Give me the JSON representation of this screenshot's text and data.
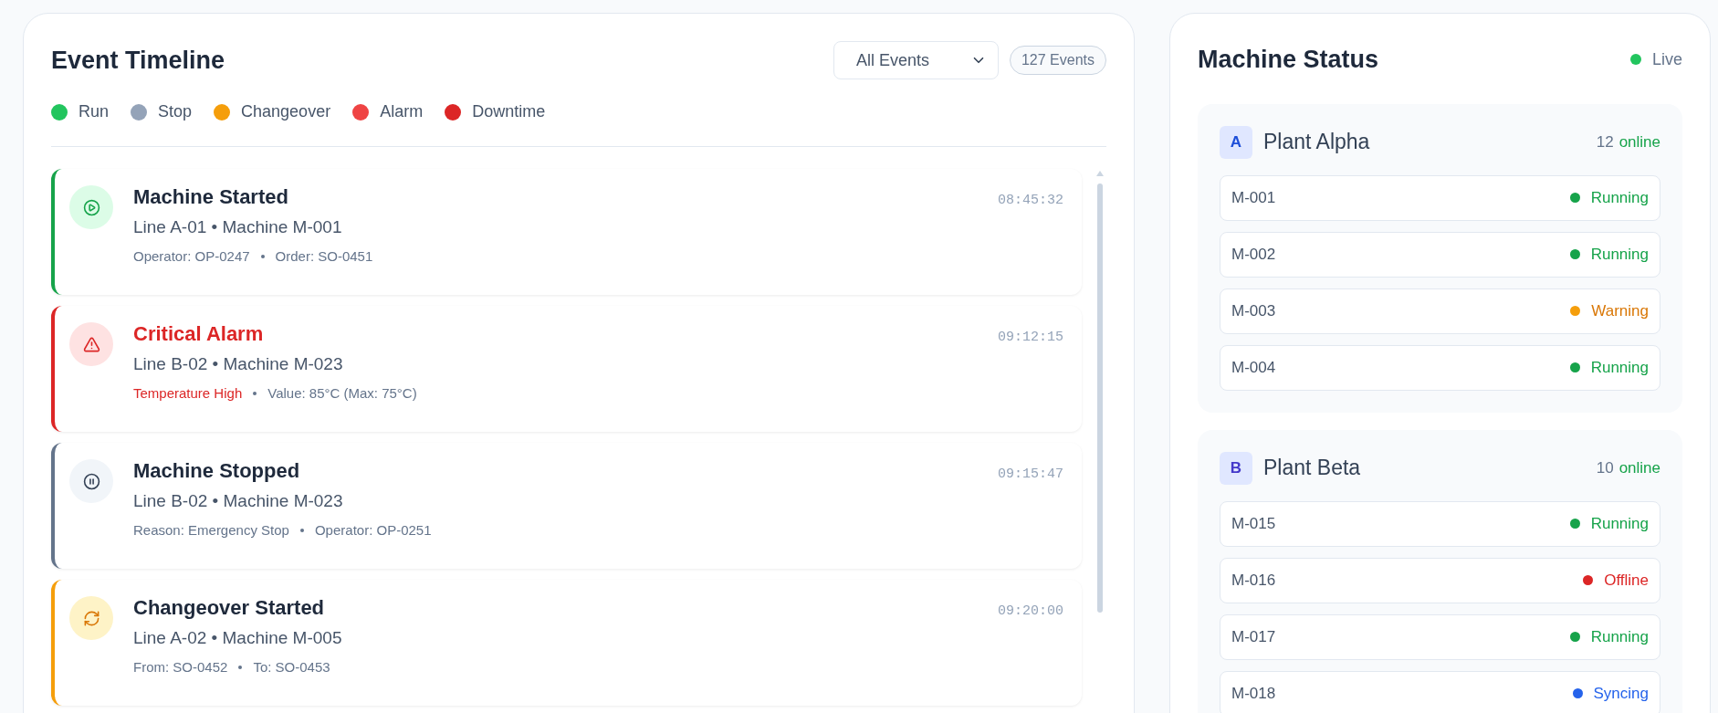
{
  "timeline": {
    "title": "Event Timeline",
    "filter": {
      "value": "All Events"
    },
    "count": "127 Events",
    "legend": [
      {
        "label": "Run",
        "color": "#22c55e"
      },
      {
        "label": "Stop",
        "color": "#94a3b8"
      },
      {
        "label": "Changeover",
        "color": "#f59e0b"
      },
      {
        "label": "Alarm",
        "color": "#ef4444"
      },
      {
        "label": "Downtime",
        "color": "#dc2626"
      }
    ],
    "events": [
      {
        "kind": "run",
        "title": "Machine Started",
        "location": "Line A-01 • Machine M-001",
        "time": "08:45:32",
        "details": [
          {
            "text": "Operator: OP-0247",
            "alert": false
          },
          {
            "text": "Order: SO-0451",
            "alert": false
          }
        ]
      },
      {
        "kind": "alarm",
        "title": "Critical Alarm",
        "location": "Line B-02 • Machine M-023",
        "time": "09:12:15",
        "details": [
          {
            "text": "Temperature High",
            "alert": true
          },
          {
            "text": "Value: 85°C (Max: 75°C)",
            "alert": false
          }
        ]
      },
      {
        "kind": "stop",
        "title": "Machine Stopped",
        "location": "Line B-02 • Machine M-023",
        "time": "09:15:47",
        "details": [
          {
            "text": "Reason: Emergency Stop",
            "alert": false
          },
          {
            "text": "Operator: OP-0251",
            "alert": false
          }
        ]
      },
      {
        "kind": "changeover",
        "title": "Changeover Started",
        "location": "Line A-02 • Machine M-005",
        "time": "09:20:00",
        "details": [
          {
            "text": "From: SO-0452",
            "alert": false
          },
          {
            "text": "To: SO-0453",
            "alert": false
          }
        ]
      }
    ]
  },
  "machine_status": {
    "title": "Machine Status",
    "live": "Live",
    "plants": [
      {
        "letter": "A",
        "name": "Plant Alpha",
        "count": "12",
        "count_label": "online",
        "color": "#1d4ed8",
        "machines": [
          {
            "id": "M-001",
            "status": "Running",
            "kind": "running"
          },
          {
            "id": "M-002",
            "status": "Running",
            "kind": "running"
          },
          {
            "id": "M-003",
            "status": "Warning",
            "kind": "warning"
          },
          {
            "id": "M-004",
            "status": "Running",
            "kind": "running"
          }
        ]
      },
      {
        "letter": "B",
        "name": "Plant Beta",
        "count": "10",
        "count_label": "online",
        "color": "#4338ca",
        "machines": [
          {
            "id": "M-015",
            "status": "Running",
            "kind": "running"
          },
          {
            "id": "M-016",
            "status": "Offline",
            "kind": "offline"
          },
          {
            "id": "M-017",
            "status": "Running",
            "kind": "running"
          },
          {
            "id": "M-018",
            "status": "Syncing",
            "kind": "syncing"
          }
        ]
      }
    ]
  }
}
